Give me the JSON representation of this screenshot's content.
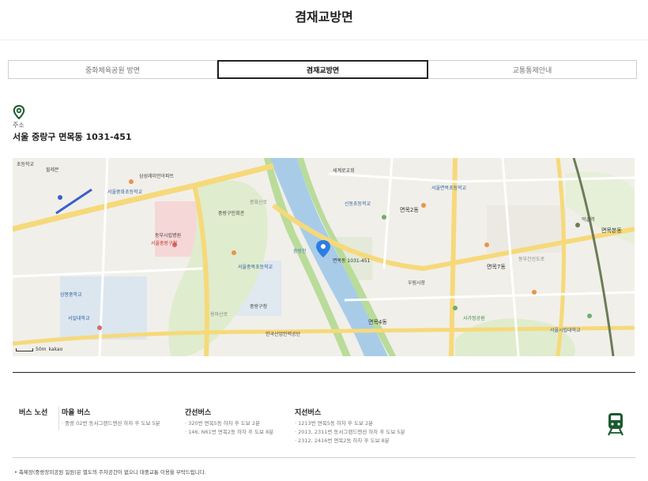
{
  "page": {
    "title": "겸재교방면"
  },
  "tabs": [
    {
      "label": "중화체육공원 방면"
    },
    {
      "label": "겸재교방면"
    },
    {
      "label": "교통통제안내"
    }
  ],
  "address": {
    "label": "주소",
    "value": "서울 중랑구 면목동 1031-451"
  },
  "map": {
    "scale_text": "50m",
    "brand": "kakao",
    "labels": {
      "l1": "초등학교",
      "l2": "힐레븐",
      "l3": "서울중화초등학교",
      "l4": "삼성래미안아파트",
      "l5": "세계로교회",
      "l6": "봉화산로",
      "l7": "중랑구민회관",
      "l8": "신동초등학교",
      "l9": "면목2동",
      "l10": "서울면목초등학교",
      "l11": "먹골역",
      "l12": "면목본동",
      "l13": "서울중랑구청",
      "l14": "동부시립병원",
      "l15": "중랑천",
      "l16": "면목동 1031-451",
      "l17": "서울중목초등학교",
      "l18": "상봉중학교",
      "l19": "서일대학교",
      "l20": "우림시장",
      "l21": "사가정공원",
      "l22": "면목7동",
      "l23": "한국산업인력공단",
      "l24": "서울시립대학교",
      "l25": "중랑구청",
      "l26": "면목4동",
      "l27": "용마산로",
      "l28": "동부간선도로"
    }
  },
  "bus": {
    "heading": "버스 노선",
    "groups": [
      {
        "title": "마을 버스",
        "items": [
          "중랑 02번 동서그랜드맨션 하차 후 도보 5분"
        ]
      },
      {
        "title": "간선버스",
        "items": [
          "320번 면목5동 하차 후 도보 2분",
          "146, N61번 면목2동 하차 후 도보 8분"
        ]
      },
      {
        "title": "지선버스",
        "items": [
          "1213번 면목5동 하차 후 도보 2분",
          "2013, 2311번 동서그랜드맨션 하차 후 도보 5분",
          "2312, 2416번 면목2동 하차 후 도보 8분"
        ]
      }
    ]
  },
  "notice": "축제장(중랑장미공원 일원)은 별도의 주차공간이 없으니 대중교통 이용을 부탁드립니다.",
  "colors": {
    "accent": "#1a5b2e",
    "map_river": "#a8cce8",
    "map_marker": "#2f7de1"
  },
  "icons": {
    "address_pin": "pin-icon",
    "subway": "train-icon"
  }
}
